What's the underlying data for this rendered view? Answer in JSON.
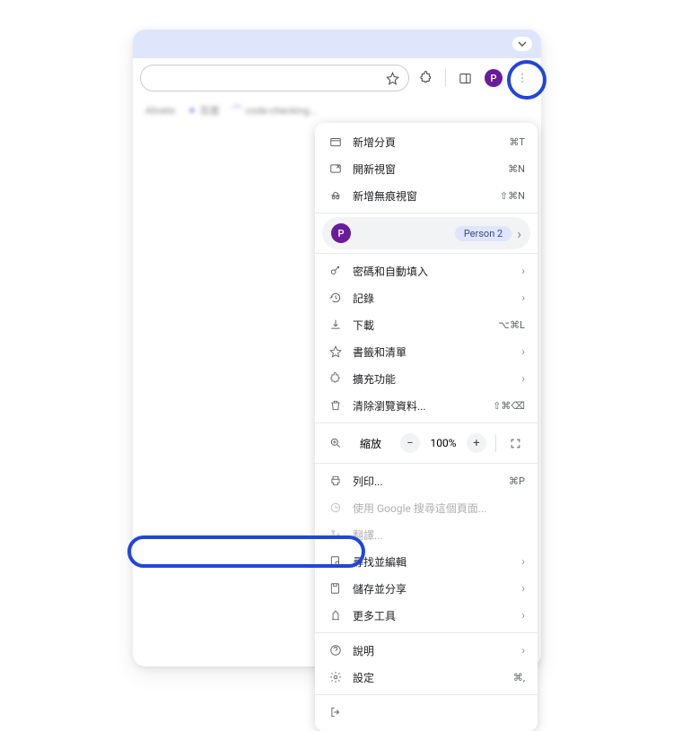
{
  "toolbar": {
    "avatar_letter": "P"
  },
  "profile": {
    "avatar_letter": "P",
    "name": "Person 2"
  },
  "zoom": {
    "label": "縮放",
    "value": "100%"
  },
  "menu": {
    "new_tab": {
      "label": "新增分頁",
      "shortcut": "⌘T"
    },
    "new_window": {
      "label": "開新視窗",
      "shortcut": "⌘N"
    },
    "new_incognito": {
      "label": "新增無痕視窗",
      "shortcut": "⇧⌘N"
    },
    "passwords": {
      "label": "密碼和自動填入"
    },
    "history": {
      "label": "記錄"
    },
    "downloads": {
      "label": "下載",
      "shortcut": "⌥⌘L"
    },
    "bookmarks": {
      "label": "書籤和清單"
    },
    "extensions": {
      "label": "擴充功能"
    },
    "clear_data": {
      "label": "清除瀏覽資料...",
      "shortcut": "⇧⌘⌫"
    },
    "print": {
      "label": "列印...",
      "shortcut": "⌘P"
    },
    "google_search": {
      "label": "使用 Google 搜尋這個頁面..."
    },
    "translate": {
      "label": "翻譯..."
    },
    "find": {
      "label": "尋找並編輯"
    },
    "save_share": {
      "label": "儲存並分享"
    },
    "more_tools": {
      "label": "更多工具"
    },
    "help": {
      "label": "說明"
    },
    "settings": {
      "label": "設定",
      "shortcut": "⌘,"
    },
    "exit": {
      "label": ""
    }
  }
}
